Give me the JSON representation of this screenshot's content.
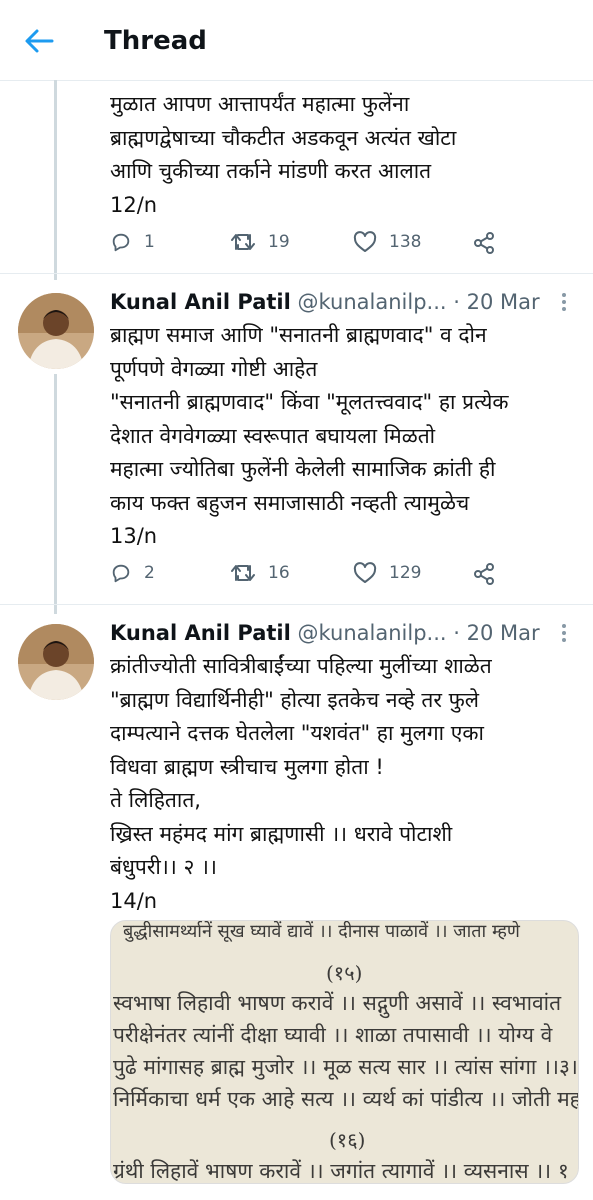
{
  "header": {
    "title": "Thread"
  },
  "tweets": [
    {
      "text": "मुळात आपण आत्तापर्यंत महात्मा फुलेंना\nब्राह्मणद्वेषाच्या चौकटीत अडकवून अत्यंत खोटा\nआणि चुकीच्या तर्काने मांडणी करत आलात\n12/n",
      "replies": "1",
      "retweets": "19",
      "likes": "138"
    },
    {
      "name": "Kunal Anil Patil",
      "handle": "@kunalanilp...",
      "time": "· 20 Mar",
      "text": "ब्राह्मण समाज आणि \"सनातनी ब्राह्मणवाद\" व दोन\nपूर्णपणे वेगळ्या गोष्टी आहेत\n\"सनातनी ब्राह्मणवाद\" किंवा \"मूलतत्त्ववाद\" हा प्रत्येक\nदेशात वेगवेगळ्या स्वरूपात बघायला मिळतो\nमहात्मा ज्योतिबा फुलेंनी केलेली सामाजिक क्रांती ही\nकाय फक्त बहुजन समाजासाठी नव्हती त्यामुळेच\n13/n",
      "replies": "2",
      "retweets": "16",
      "likes": "129"
    },
    {
      "name": "Kunal Anil Patil",
      "handle": "@kunalanilp...",
      "time": "· 20 Mar",
      "text": "क्रांतीज्योती सावित्रीबाईंच्या पहिल्या मुलींच्या शाळेत\n\"ब्राह्मण विद्यार्थिनीही\" होत्या इतकेच नव्हे तर फुले\nदाम्पत्याने दत्तक घेतलेला \"यशवंत\" हा मुलगा एका\nविधवा ब्राह्मण स्त्रीचाच मुलगा होता !\nते लिहितात,\nख्रिस्त महंमद मांग ब्राह्मणासी ।। धरावे पोटाशी\nबंधुपरी।। २ ।।\n14/n"
    }
  ],
  "photo": {
    "lines": [
      "बुद्धीसामर्थ्यानें सूख घ्यावें द्यावें ।। दीनास पाळावें ।। जाता म्हणे",
      "स्वभाषा लिहावी भाषण करावें ।। सद्गुणी असावें ।। स्वभावांत",
      "परीक्षेनंतर त्यांनीं दीक्षा घ्यावी ।। शाळा तपासावी ।। योग्य वे",
      "पुढे मांगासह ब्राह्म मुजोर ।। मूळ सत्य सार ।। त्यांस सांगा ।।३।।",
      "निर्मिकाचा धर्म एक आहे सत्य ।। व्यर्थ कां पांडीत्य ।। जोती मह",
      "ग्रंथी लिहावें भाषण करावें ।। जगांत त्यागावें ।। व्यसनास ।। १"
    ],
    "num1": "(१५)",
    "num2": "(१६)"
  }
}
